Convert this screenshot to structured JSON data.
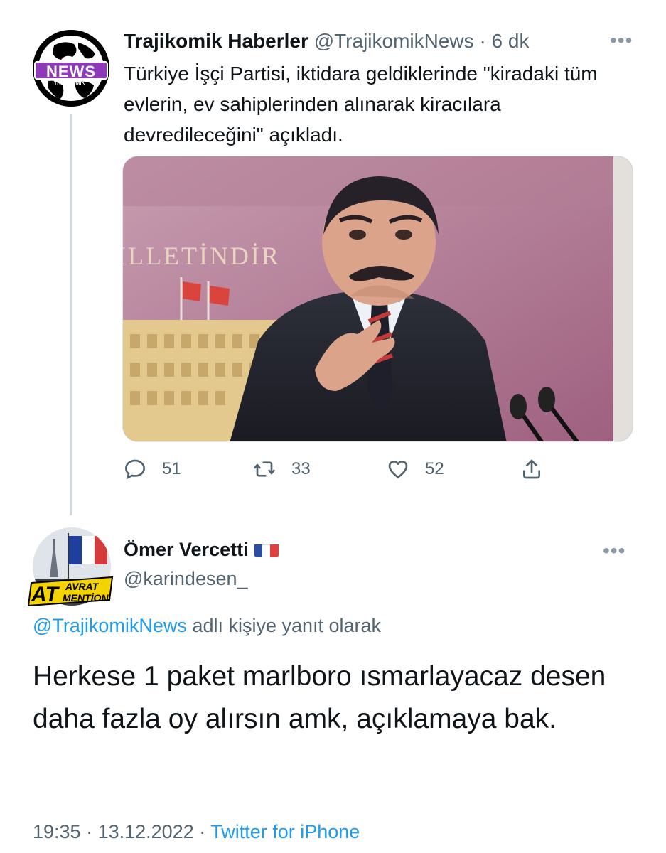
{
  "tweet1": {
    "avatar_badge": "NEWS",
    "avatar_small_text": "TRAJİKOMİK",
    "name": "Trajikomik Haberler",
    "handle": "@TrajikomikNews",
    "separator": "·",
    "time": "6 dk",
    "more_icon": "more-dots-icon",
    "text": "Türkiye İşçi Partisi, iktidara geldiklerinde \"kiradaki tüm evlerin, ev sahiplerinden alınarak kiracılara devredileceğini\" açıkladı.",
    "image_wall_text": "İLLETİNDİR",
    "actions": {
      "replies": "51",
      "retweets": "33",
      "likes": "52",
      "reply_icon": "reply-icon",
      "retweet_icon": "retweet-icon",
      "like_icon": "heart-icon",
      "share_icon": "share-icon"
    }
  },
  "tweet2": {
    "avatar_text_1": "AT",
    "avatar_text_2": "AVRAT",
    "avatar_text_3": "MENTİON",
    "name": "Ömer Vercetti",
    "flag_icon": "france-flag-icon",
    "handle": "@karindesen_",
    "reply_mention": "@TrajikomikNews",
    "reply_suffix": " adlı kişiye yanıt olarak",
    "text": "Herkese 1 paket marlboro ısmarlayacaz desen daha fazla oy alırsın amk, açıklamaya bak.",
    "time": "19:35",
    "separator": " · ",
    "date": "13.12.2022",
    "source": "Twitter for iPhone"
  },
  "colors": {
    "link": "#1d9bf0",
    "muted": "#536471",
    "text": "#0f1419",
    "badge": "#8e3ab8"
  }
}
